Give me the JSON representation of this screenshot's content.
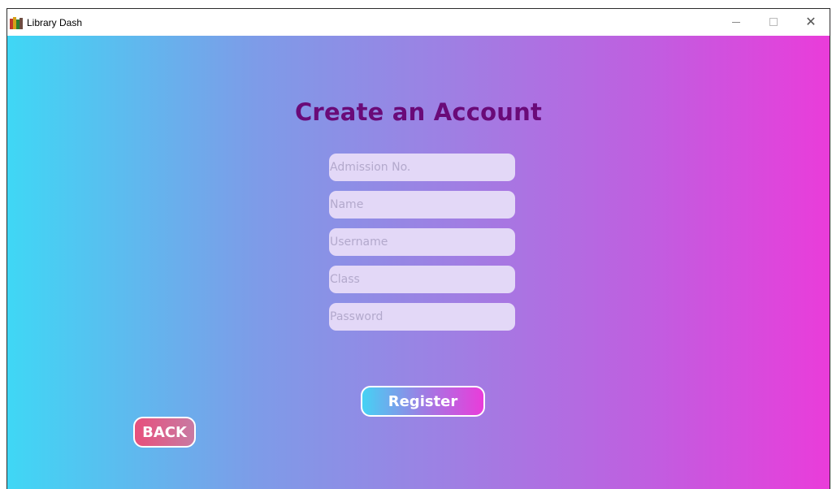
{
  "window": {
    "title": "Library Dash",
    "app_icon": "books-icon",
    "controls": {
      "minimize_icon": "minimize-icon",
      "maximize_icon": "maximize-icon",
      "close_icon": "close-icon",
      "close_glyph": "✕"
    }
  },
  "form": {
    "heading": "Create an Account",
    "fields": [
      {
        "placeholder": "Admission No.",
        "value": ""
      },
      {
        "placeholder": "Name",
        "value": ""
      },
      {
        "placeholder": "Username",
        "value": ""
      },
      {
        "placeholder": "Class",
        "value": ""
      },
      {
        "placeholder": "Password",
        "value": ""
      }
    ],
    "register_label": "Register",
    "back_label": "BACK"
  },
  "colors": {
    "gradient_start": "#3fd7f5",
    "gradient_end": "#ea3cda",
    "heading": "#6a0a78",
    "field_bg": "#e3d8f7"
  }
}
